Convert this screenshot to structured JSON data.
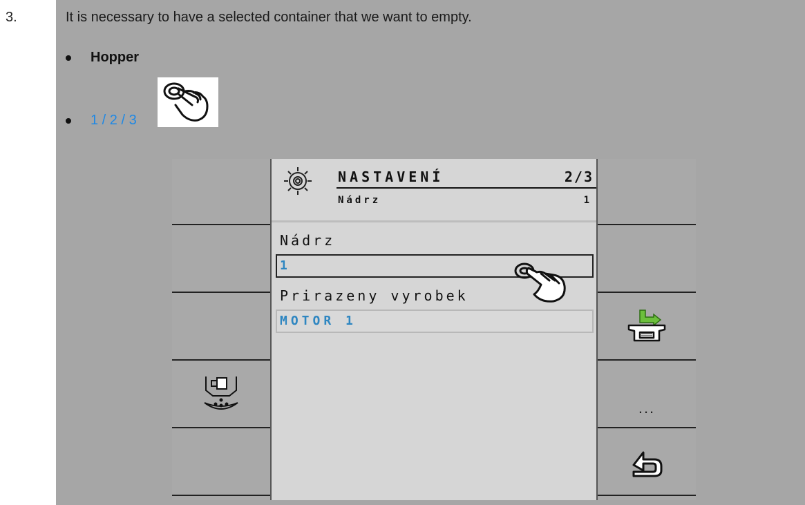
{
  "step": {
    "number": "3."
  },
  "instruction": "It is necessary to have a selected container that we want to empty.",
  "bullets": [
    {
      "text": "Hopper"
    },
    {
      "text": "1 / 2 / 3"
    }
  ],
  "screen": {
    "title": "NASTAVENÍ",
    "page": "2/3",
    "subtitle": "Nádrz",
    "subtitle_value": "1",
    "fields": [
      {
        "label": "Nádrz",
        "value": "1"
      },
      {
        "label": "Prirazeny vyrobek",
        "value": "MOTOR 1"
      }
    ]
  },
  "softkeys": {
    "left": [
      "",
      "",
      "",
      "dosing-unit-icon",
      ""
    ],
    "right": [
      "",
      "",
      "empty-container-icon",
      "...",
      "back-icon"
    ],
    "more_label": "..."
  },
  "colors": {
    "link_blue": "#1e88e5",
    "field_blue": "#2e86c1",
    "green_arrow": "#6cbf3c"
  }
}
